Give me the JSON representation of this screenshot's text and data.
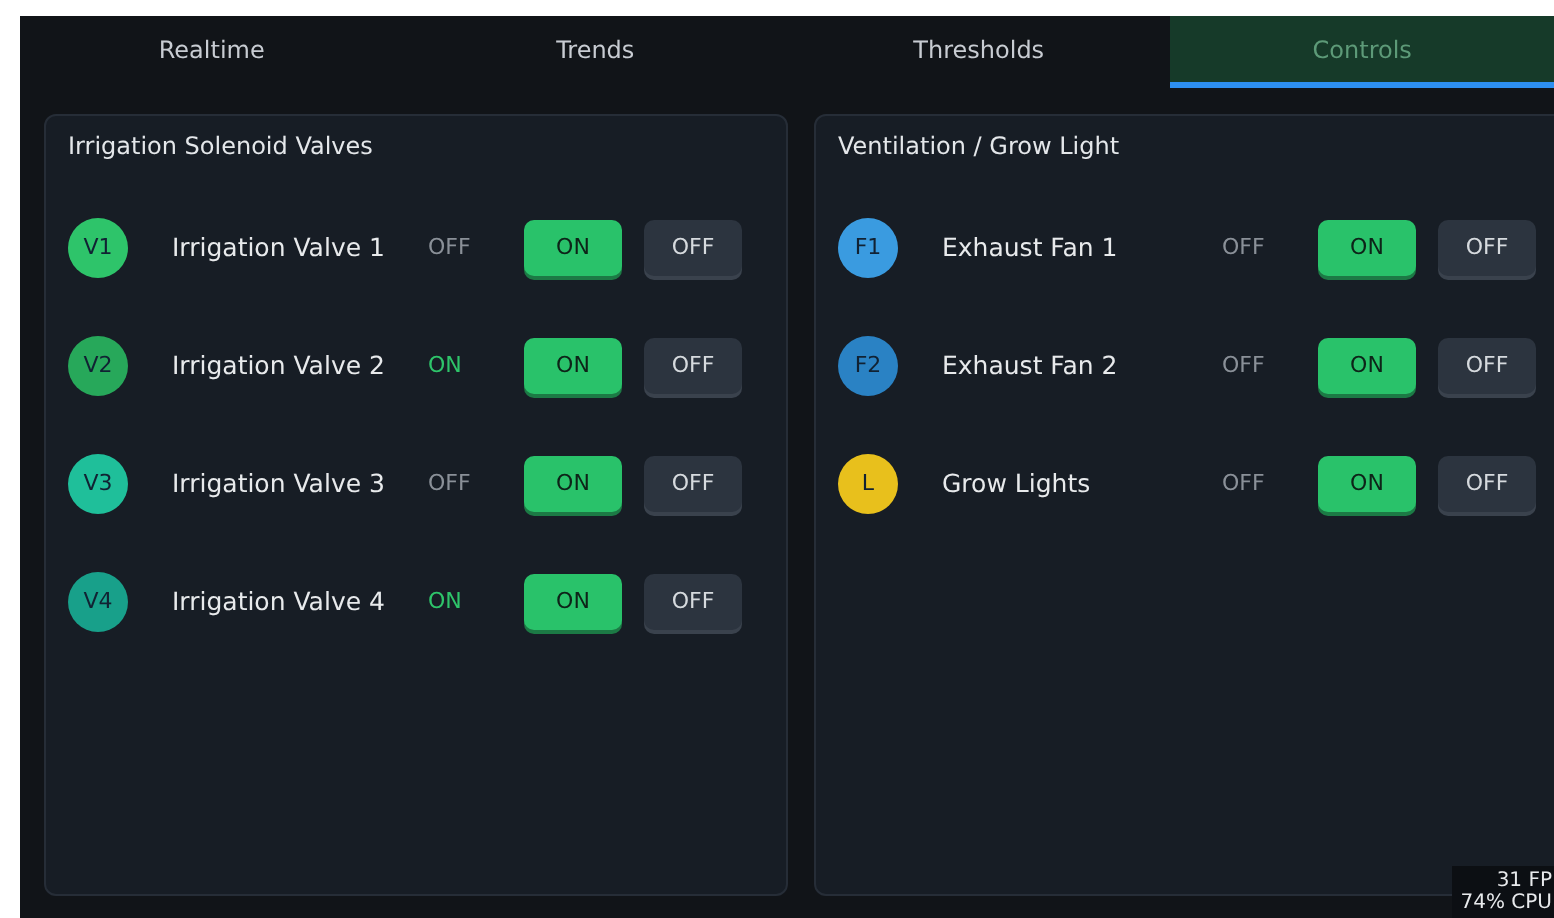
{
  "tabs": [
    {
      "label": "Realtime",
      "selected": false
    },
    {
      "label": "Trends",
      "selected": false
    },
    {
      "label": "Thresholds",
      "selected": false
    },
    {
      "label": "Controls",
      "selected": true
    }
  ],
  "panels": [
    {
      "title": "Irrigation Solenoid Valves",
      "devices": [
        {
          "badge": "V1",
          "color": "#2ec46a",
          "name": "Irrigation Valve 1",
          "status": "OFF",
          "on": false,
          "on_button": "ON",
          "off_button": "OFF"
        },
        {
          "badge": "V2",
          "color": "#27a85a",
          "name": "Irrigation Valve 2",
          "status": "ON",
          "on": true,
          "on_button": "ON",
          "off_button": "OFF"
        },
        {
          "badge": "V3",
          "color": "#1fbf9a",
          "name": "Irrigation Valve 3",
          "status": "OFF",
          "on": false,
          "on_button": "ON",
          "off_button": "OFF"
        },
        {
          "badge": "V4",
          "color": "#18a08a",
          "name": "Irrigation Valve 4",
          "status": "ON",
          "on": true,
          "on_button": "ON",
          "off_button": "OFF"
        }
      ]
    },
    {
      "title": "Ventilation / Grow Light",
      "devices": [
        {
          "badge": "F1",
          "color": "#3a9be0",
          "name": "Exhaust Fan 1",
          "status": "OFF",
          "on": false,
          "on_button": "ON",
          "off_button": "OFF"
        },
        {
          "badge": "F2",
          "color": "#2a82c4",
          "name": "Exhaust Fan 2",
          "status": "OFF",
          "on": false,
          "on_button": "ON",
          "off_button": "OFF"
        },
        {
          "badge": "L",
          "color": "#e8c01c",
          "name": "Grow Lights",
          "status": "OFF",
          "on": false,
          "on_button": "ON",
          "off_button": "OFF"
        }
      ]
    }
  ],
  "overlay": {
    "fps": "31 FP",
    "cpu": "74% CPU"
  }
}
